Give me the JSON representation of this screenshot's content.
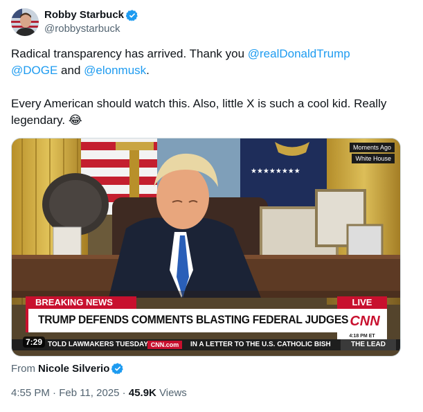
{
  "author": {
    "display_name": "Robby Starbuck",
    "handle": "@robbystarbuck",
    "verified_icon": "verified-badge-icon",
    "avatar_icon": "avatar-photo"
  },
  "tweet": {
    "line1_prefix": "Radical transparency has arrived. Thank you ",
    "mention1": "@realDonaldTrump",
    "mention2": "@DOGE",
    "and_text": " and ",
    "mention3": "@elonmusk",
    "line1_suffix": ".",
    "paragraph2": "Every American should watch this. Also, little X is such a cool kid. Really legendary. ",
    "emoji": "😂"
  },
  "media": {
    "badge_moments": "Moments Ago",
    "badge_location": "White House",
    "breaking_label": "BREAKING NEWS",
    "live_label": "LIVE",
    "headline": "TRUMP DEFENDS COMMENTS BLASTING FEDERAL JUDGES",
    "network_logo": "CNN",
    "time_label": "4:18 PM ET",
    "ticker_left": "TOLD LAWMAKERS TUESDAY.",
    "ticker_cnn": "CNN.com",
    "ticker_right": "IN A LETTER TO THE U.S. CATHOLIC BISH",
    "ticker_show": "THE LEAD",
    "duration": "7:29"
  },
  "attribution": {
    "from_label": "From",
    "source_name": "Nicole Silverio"
  },
  "meta": {
    "time": "4:55 PM",
    "date": "Feb 11, 2025",
    "separator": " · ",
    "views_count": "45.9K",
    "views_label": "Views"
  },
  "colors": {
    "link": "#1d9bf0",
    "secondary": "#536471",
    "primary_text": "#0f1419",
    "cnn_red": "#c8102e"
  }
}
